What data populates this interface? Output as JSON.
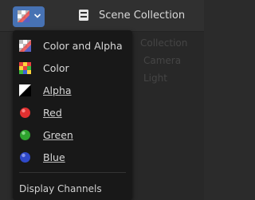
{
  "header": {
    "channel_button_icon": "color-alpha-checker-icon",
    "scene_icon": "scene-collection-icon",
    "scene_title": "Scene Collection"
  },
  "background_outliner": {
    "rows": [
      "Collection",
      "Camera",
      "Light"
    ]
  },
  "menu": {
    "title": "Display Channels",
    "items": [
      {
        "label": "Color and Alpha",
        "icon": "color-alpha-checker-icon"
      },
      {
        "label": "Color",
        "icon": "color-checker-icon"
      },
      {
        "label": "Alpha",
        "icon": "alpha-icon"
      },
      {
        "label": "Red",
        "icon": "red-channel-icon",
        "color": "#e03030"
      },
      {
        "label": "Green",
        "icon": "green-channel-icon",
        "color": "#2ea32e"
      },
      {
        "label": "Blue",
        "icon": "blue-channel-icon",
        "color": "#2f49c9"
      }
    ]
  },
  "colors": {
    "accent": "#4772b3",
    "menu_background": "#181818",
    "text": "#d8d8d8"
  }
}
